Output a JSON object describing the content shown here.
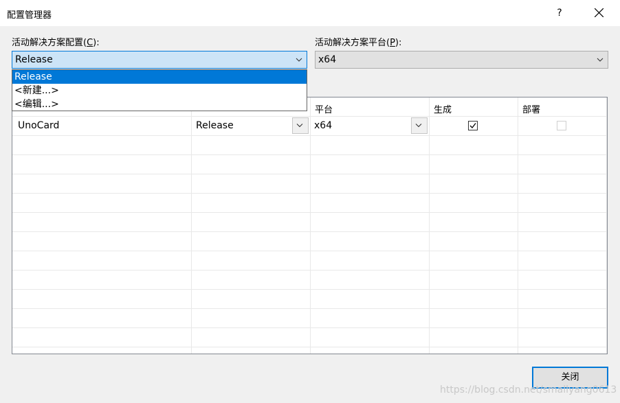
{
  "window": {
    "title": "配置管理器",
    "help_label": "?"
  },
  "solution_config": {
    "label_prefix": "活动解决方案配置(",
    "label_key": "C",
    "label_suffix": "):",
    "value": "Release",
    "options": [
      "Release",
      "<新建...>",
      "<编辑...>"
    ]
  },
  "solution_platform": {
    "label_prefix": "活动解决方案平台(",
    "label_key": "P",
    "label_suffix": "):",
    "value": "x64"
  },
  "grid": {
    "headers": {
      "platform": "平台",
      "build": "生成",
      "deploy": "部署"
    },
    "rows": [
      {
        "project": "UnoCard",
        "configuration": "Release",
        "platform": "x64",
        "build": true,
        "deploy": false
      }
    ]
  },
  "footer": {
    "close_label": "关闭"
  },
  "watermark": "https://blog.csdn.net/smallyang0613"
}
